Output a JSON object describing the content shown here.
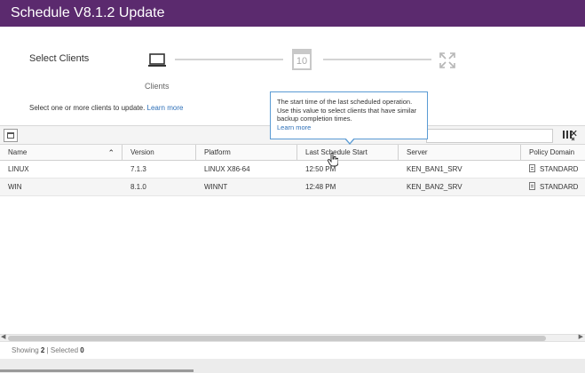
{
  "window": {
    "title": "Schedule V8.1.2 Update"
  },
  "wizard": {
    "step_title": "Select Clients",
    "calendar_day": "10",
    "step_label": "Clients",
    "instruction": "Select one or more clients to update.",
    "instruction_link": "Learn more"
  },
  "toolbar": {
    "filter_value": ""
  },
  "table": {
    "columns": [
      "Name",
      "Version",
      "Platform",
      "Last Schedule Start",
      "Server",
      "Policy Domain"
    ],
    "rows": [
      {
        "name": "LINUX",
        "version": "7.1.3",
        "platform": "LINUX X86-64",
        "last_start": "12:50 PM",
        "server": "KEN_BAN1_SRV",
        "policy_domain": "STANDARD"
      },
      {
        "name": "WIN",
        "version": "8.1.0",
        "platform": "WINNT",
        "last_start": "12:48 PM",
        "server": "KEN_BAN2_SRV",
        "policy_domain": "STANDARD"
      }
    ]
  },
  "tooltip": {
    "text": "The start time of the last scheduled operation. Use this value to select clients that have similar backup completion times.",
    "link": "Learn more"
  },
  "status": {
    "showing_label": "Showing",
    "showing_count": "2",
    "separator": "|",
    "selected_label": "Selected",
    "selected_count": "0"
  },
  "icons": {
    "laptop": "laptop-icon",
    "calendar": "calendar-icon",
    "expand": "expand-icon",
    "export": "export-icon",
    "clear": "close-icon",
    "columns": "columns-icon",
    "document": "document-icon",
    "sort": "chevron-up-icon"
  },
  "colors": {
    "titlebar": "#5b2a6e",
    "link": "#2e70b8",
    "tooltip_border": "#5a9bd4"
  }
}
